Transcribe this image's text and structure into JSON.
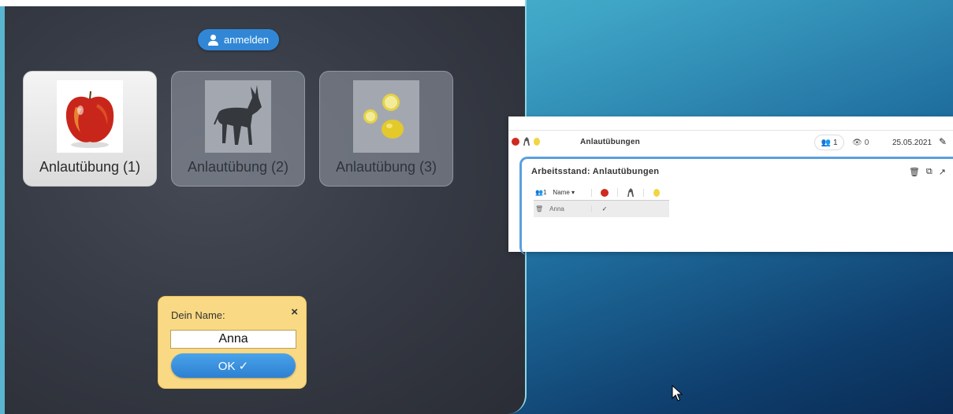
{
  "login": {
    "label": "anmelden",
    "icon": "user-icon"
  },
  "cards": [
    {
      "label": "Anlautübung (1)",
      "image": "apple",
      "active": true
    },
    {
      "label": "Anlautübung (2)",
      "image": "donkey",
      "active": false
    },
    {
      "label": "Anlautübung (3)",
      "image": "lemon",
      "active": false
    }
  ],
  "name_dialog": {
    "label": "Dein Name:",
    "close": "×",
    "input_value": "Anna",
    "ok_label": "OK ✓"
  },
  "overview": {
    "title": "Anlautübungen",
    "participants": "1",
    "views": "0",
    "date": "25.05.2021",
    "edit_icon": "pencil-icon",
    "panel_title": "Arbeitsstand: Anlautübungen",
    "tools": [
      "trash-icon",
      "copy-icon",
      "external-link-icon"
    ],
    "table": {
      "count": "1",
      "name_header": "Name ▾",
      "exercise_icons": [
        "apple-icon",
        "donkey-icon",
        "lemon-icon"
      ],
      "rows": [
        {
          "name": "Anna",
          "marks": [
            "✓",
            "",
            ""
          ]
        }
      ]
    }
  },
  "colors": {
    "accent_blue": "#3187d6",
    "dialog_yellow": "#f9d984",
    "panel_dark": "#363a44",
    "frame_blue": "#5a9fde"
  }
}
